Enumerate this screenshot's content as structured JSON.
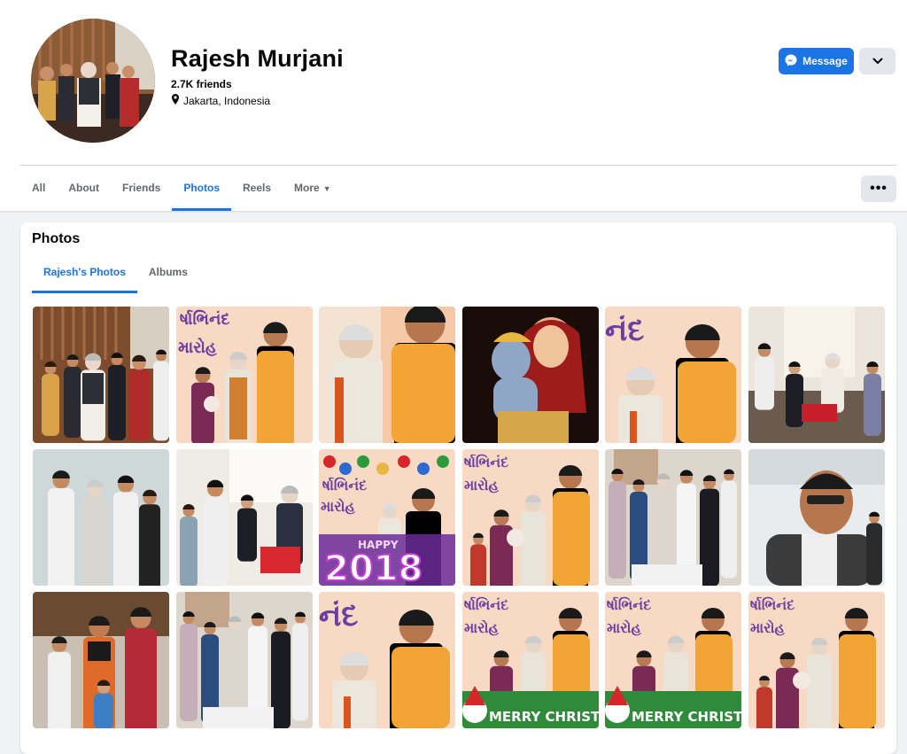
{
  "profile": {
    "name": "Rajesh Murjani",
    "friends": "2.7K friends",
    "location": "Jakarta, Indonesia"
  },
  "actions": {
    "message_label": "Message",
    "message_icon": "messenger-icon",
    "dropdown_icon": "chevron-down-icon",
    "more_options_icon": "ellipsis-icon"
  },
  "tabs": [
    {
      "label": "All"
    },
    {
      "label": "About"
    },
    {
      "label": "Friends"
    },
    {
      "label": "Photos",
      "active": true
    },
    {
      "label": "Reels"
    },
    {
      "label": "More"
    }
  ],
  "photos_section": {
    "title": "Photos",
    "subtabs": [
      {
        "label": "Rajesh's Photos",
        "active": true
      },
      {
        "label": "Albums"
      }
    ]
  },
  "photos": [
    {
      "scene": "group-reception"
    },
    {
      "scene": "banner-ceremony"
    },
    {
      "scene": "closeup-two-men"
    },
    {
      "scene": "painting-krishna"
    },
    {
      "scene": "banner-closeup"
    },
    {
      "scene": "living-room-group"
    },
    {
      "scene": "four-people-standing"
    },
    {
      "scene": "living-room-sofa"
    },
    {
      "scene": "new-year-2018"
    },
    {
      "scene": "banner-ceremony-child"
    },
    {
      "scene": "family-group-indoor"
    },
    {
      "scene": "selfie-airplane"
    },
    {
      "scene": "family-with-guru"
    },
    {
      "scene": "family-group-indoor"
    },
    {
      "scene": "banner-closeup"
    },
    {
      "scene": "merry-christmas"
    },
    {
      "scene": "merry-christmas"
    },
    {
      "scene": "banner-ceremony-child"
    }
  ],
  "overlay_texts": {
    "banner_top": "ર્ષાભિનંદ",
    "banner_bottom": "મારોહ",
    "banner_nand": "નંદ",
    "happy": "HAPPY",
    "year": "2018",
    "christmas": "MERRY CHRISTMAS!"
  },
  "colors": {
    "accent": "#1b74e4",
    "saffron": "#f2a535",
    "banner_bg": "#f7d9c4",
    "banner_text": "#6b3fa0"
  }
}
